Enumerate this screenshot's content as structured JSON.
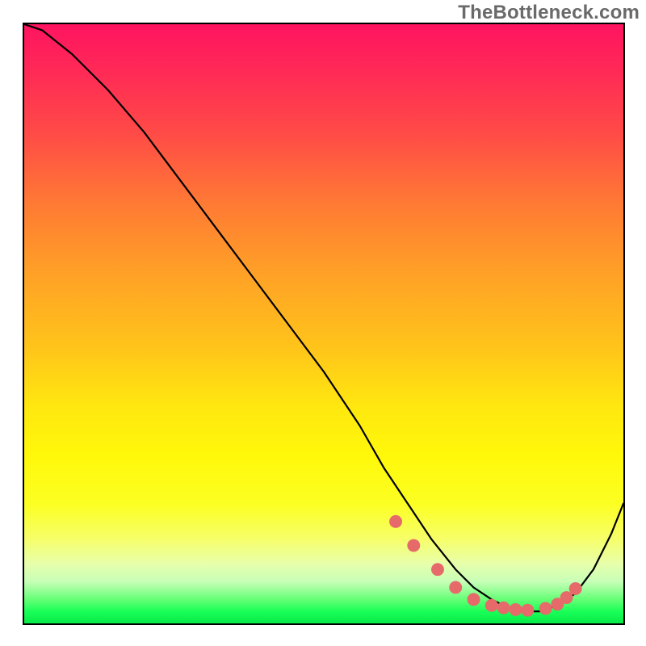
{
  "watermark": "TheBottleneck.com",
  "colors": {
    "curve": "#000000",
    "marker": "#e66a6a",
    "border": "#000000",
    "gradient_stops": [
      "#ff1460",
      "#ff2a56",
      "#ff4a47",
      "#ff7a34",
      "#ffa226",
      "#ffc41a",
      "#ffe80f",
      "#fff80a",
      "#fcff22",
      "#f6ff6a",
      "#e8ffab",
      "#c7ffb7",
      "#66ff76",
      "#19ff57",
      "#07ea49"
    ]
  },
  "chart_data": {
    "type": "line",
    "title": "",
    "xlabel": "",
    "ylabel": "",
    "xlim": [
      0,
      100
    ],
    "ylim": [
      0,
      100
    ],
    "axes_visible": false,
    "legend": false,
    "background": "vertical heat gradient (red top → yellow mid → green bottom)",
    "series": [
      {
        "name": "bottleneck-curve",
        "x": [
          0,
          3,
          8,
          14,
          20,
          26,
          32,
          38,
          44,
          50,
          56,
          60,
          64,
          68,
          72,
          75,
          78,
          80,
          83,
          86,
          89,
          92,
          95,
          98,
          100
        ],
        "y": [
          100,
          99,
          95,
          89,
          82,
          74,
          66,
          58,
          50,
          42,
          33,
          26,
          20,
          14,
          9,
          6,
          4,
          3,
          2,
          2,
          3,
          5,
          9,
          15,
          20
        ]
      }
    ],
    "markers": {
      "name": "flat-valley-points",
      "x": [
        62,
        65,
        69,
        72,
        75,
        78,
        80,
        82,
        84,
        87,
        89,
        90.5,
        92
      ],
      "y": [
        17,
        13,
        9,
        6,
        4,
        3,
        2.6,
        2.3,
        2.2,
        2.5,
        3.2,
        4.3,
        5.8
      ],
      "radius_px": 8
    }
  }
}
